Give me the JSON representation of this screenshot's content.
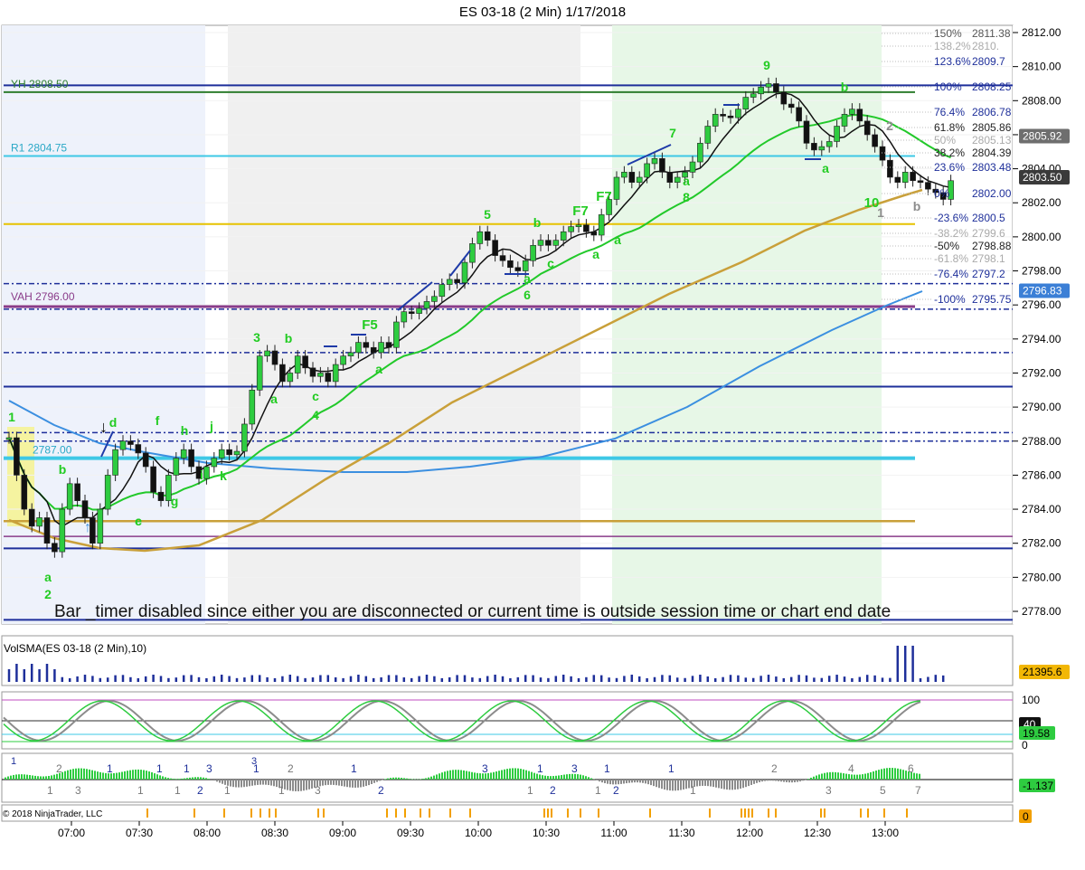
{
  "header": {
    "title": "ES 03-18 (2 Min)  1/17/2018"
  },
  "chart_data": {
    "type": "candlestick",
    "instrument": "ES 03-18 (2 Min)",
    "date": "1/17/2018",
    "ylim": [
      2777,
      2812.5
    ],
    "y_ticks": [
      "2812.00",
      "2810.00",
      "2808.00",
      "2806.00",
      "2804.00",
      "2802.00",
      "2800.00",
      "2798.00",
      "2796.00",
      "2794.00",
      "2792.00",
      "2790.00",
      "2788.00",
      "2786.00",
      "2784.00",
      "2782.00",
      "2780.00",
      "2778.00"
    ],
    "y_tick_values": [
      2812,
      2810,
      2808,
      2806,
      2804,
      2802,
      2800,
      2798,
      2796,
      2794,
      2792,
      2790,
      2788,
      2786,
      2784,
      2782,
      2780,
      2778
    ],
    "x_ticks": [
      "07:00",
      "07:30",
      "08:00",
      "08:30",
      "09:00",
      "09:30",
      "10:00",
      "10:30",
      "11:00",
      "11:30",
      "12:00",
      "12:30",
      "13:00"
    ],
    "price_path": [
      [
        0,
        2788.2
      ],
      [
        2,
        2786
      ],
      [
        4,
        2784
      ],
      [
        6,
        2783
      ],
      [
        8,
        2783.5
      ],
      [
        10,
        2782
      ],
      [
        12,
        2781.5
      ],
      [
        14,
        2784
      ],
      [
        16,
        2785.5
      ],
      [
        18,
        2784.5
      ],
      [
        20,
        2783.5
      ],
      [
        22,
        2782
      ],
      [
        24,
        2784
      ],
      [
        26,
        2786
      ],
      [
        28,
        2787.5
      ],
      [
        30,
        2788
      ],
      [
        32,
        2787.8
      ],
      [
        34,
        2787.3
      ],
      [
        36,
        2786.5
      ],
      [
        38,
        2785
      ],
      [
        40,
        2784.5
      ],
      [
        42,
        2786
      ],
      [
        44,
        2787
      ],
      [
        46,
        2787.5
      ],
      [
        48,
        2786.5
      ],
      [
        50,
        2785.8
      ],
      [
        52,
        2786.5
      ],
      [
        54,
        2787
      ],
      [
        56,
        2787.5
      ],
      [
        58,
        2787.2
      ],
      [
        60,
        2787.4
      ],
      [
        62,
        2789
      ],
      [
        64,
        2791
      ],
      [
        66,
        2793
      ],
      [
        68,
        2793.3
      ],
      [
        70,
        2792.5
      ],
      [
        72,
        2791.5
      ],
      [
        74,
        2792
      ],
      [
        76,
        2793
      ],
      [
        78,
        2792.3
      ],
      [
        80,
        2791.8
      ],
      [
        82,
        2792
      ],
      [
        84,
        2791.5
      ],
      [
        86,
        2792.5
      ],
      [
        88,
        2793
      ],
      [
        90,
        2793.2
      ],
      [
        92,
        2793.8
      ],
      [
        94,
        2793.5
      ],
      [
        96,
        2793.2
      ],
      [
        98,
        2793.8
      ],
      [
        100,
        2793.5
      ],
      [
        102,
        2795
      ],
      [
        104,
        2795.6
      ],
      [
        106,
        2795.5
      ],
      [
        108,
        2795.8
      ],
      [
        110,
        2796.2
      ],
      [
        112,
        2796.5
      ],
      [
        114,
        2797.2
      ],
      [
        116,
        2797.5
      ],
      [
        118,
        2797.3
      ],
      [
        120,
        2798.5
      ],
      [
        122,
        2799.6
      ],
      [
        124,
        2800.3
      ],
      [
        126,
        2799.8
      ],
      [
        128,
        2798.9
      ],
      [
        130,
        2798.6
      ],
      [
        132,
        2798.2
      ],
      [
        134,
        2798
      ],
      [
        136,
        2798.6
      ],
      [
        138,
        2799.5
      ],
      [
        140,
        2799.8
      ],
      [
        142,
        2799.5
      ],
      [
        144,
        2799.8
      ],
      [
        146,
        2800.3
      ],
      [
        148,
        2800.6
      ],
      [
        150,
        2800.7
      ],
      [
        152,
        2800.3
      ],
      [
        154,
        2800.1
      ],
      [
        156,
        2801.3
      ],
      [
        158,
        2802.2
      ],
      [
        160,
        2803.5
      ],
      [
        162,
        2803.8
      ],
      [
        164,
        2803.2
      ],
      [
        166,
        2803.5
      ],
      [
        168,
        2804.3
      ],
      [
        170,
        2804.6
      ],
      [
        172,
        2803.8
      ],
      [
        174,
        2803.2
      ],
      [
        176,
        2803.5
      ],
      [
        178,
        2803.8
      ],
      [
        180,
        2804.4
      ],
      [
        182,
        2805.5
      ],
      [
        184,
        2806.5
      ],
      [
        186,
        2807.2
      ],
      [
        188,
        2807.1
      ],
      [
        190,
        2807
      ],
      [
        192,
        2807.5
      ],
      [
        194,
        2808.2
      ],
      [
        196,
        2808.4
      ],
      [
        198,
        2808.8
      ],
      [
        200,
        2809
      ],
      [
        202,
        2808.5
      ],
      [
        204,
        2807.8
      ],
      [
        206,
        2807.6
      ],
      [
        208,
        2806.8
      ],
      [
        210,
        2805.5
      ],
      [
        212,
        2805.1
      ],
      [
        214,
        2805.3
      ],
      [
        216,
        2805.6
      ],
      [
        218,
        2806.5
      ],
      [
        220,
        2807.2
      ],
      [
        222,
        2807.5
      ],
      [
        224,
        2806.8
      ],
      [
        226,
        2806
      ],
      [
        228,
        2805.3
      ],
      [
        230,
        2804.5
      ],
      [
        232,
        2803.5
      ],
      [
        234,
        2803.2
      ],
      [
        236,
        2803.8
      ],
      [
        238,
        2803.3
      ],
      [
        240,
        2803.2
      ],
      [
        242,
        2802.8
      ],
      [
        244,
        2802.6
      ],
      [
        246,
        2802.2
      ],
      [
        248,
        2803.3
      ]
    ],
    "levels": [
      {
        "label": "YH 2808.50",
        "value": 2808.5,
        "color": "#1a6b1a"
      },
      {
        "label": "R1 2804.75",
        "value": 2804.75,
        "color": "#3ec8e6"
      },
      {
        "label": "VAH 2796.00",
        "value": 2796.0,
        "color": "#8a3c8a"
      },
      {
        "label": "2787.00",
        "value": 2787.0,
        "color": "#3ec8e6"
      }
    ],
    "fib_levels": [
      {
        "label": "150%",
        "value": "2811.38"
      },
      {
        "label": "138.2%",
        "value": "2810."
      },
      {
        "label": "123.6%",
        "value": "2809.7"
      },
      {
        "label": "100%",
        "value": "2808.25"
      },
      {
        "label": "76.4%",
        "value": "2806.78"
      },
      {
        "label": "61.8%",
        "value": "2805.86"
      },
      {
        "label": "50%",
        "value": "2805.13"
      },
      {
        "label": "38.2%",
        "value": "2804.39"
      },
      {
        "label": "23.6%",
        "value": "2803.48"
      },
      {
        "label": "0%",
        "value": "2802.00"
      },
      {
        "label": "-23.6%",
        "value": "2800.5"
      },
      {
        "label": "-38.2%",
        "value": "2799.6"
      },
      {
        "label": "-50%",
        "value": "2798.88"
      },
      {
        "label": "-61.8%",
        "value": "2798.1"
      },
      {
        "label": "-76.4%",
        "value": "2797.2"
      },
      {
        "label": "-100%",
        "value": "2795.75"
      }
    ],
    "price_badges": [
      {
        "text": "2805.92",
        "value": 2805.92,
        "bg": "#6e6e6e",
        "fg": "#ffffff"
      },
      {
        "text": "2803.50",
        "value": 2803.5,
        "bg": "#3a3a3a",
        "fg": "#ffffff"
      },
      {
        "text": "2796.83",
        "value": 2796.83,
        "bg": "#3b7fd6",
        "fg": "#ffffff"
      }
    ],
    "wave_labels": [
      "1",
      "2",
      "a",
      "b",
      "c",
      "d",
      "e",
      "f",
      "g",
      "h",
      "i",
      "j",
      "k",
      "3",
      "b",
      "a",
      "c",
      "4",
      "F5",
      "a",
      "5",
      "b",
      "c",
      "a",
      "6",
      "a",
      "F7",
      "F7",
      "a",
      "7",
      "a",
      "8",
      "9",
      "b",
      "a",
      "2",
      "10",
      "1",
      "b"
    ],
    "notice": "Bar _timer disabled since either you are disconnected or current time is outside session time or chart end date",
    "volume_panel": {
      "label": "VolSMA(ES 03-18 (2 Min),10)",
      "badge": "21395.6"
    },
    "oscillator_panel": {
      "ticks": [
        "100",
        "0"
      ],
      "badge_top": "40",
      "badge_bottom": "19.58"
    },
    "histogram_panel": {
      "badge": "-1.137",
      "numbers_top": [
        "1",
        "2",
        "1",
        "1",
        "1",
        "3",
        "1",
        "2",
        "1",
        "3",
        "1",
        "3",
        "1",
        "1",
        "3",
        "2",
        "4",
        "6"
      ],
      "numbers_bottom": [
        "1",
        "3",
        "1",
        "1",
        "2",
        "1",
        "1",
        "3",
        "2",
        "1",
        "2",
        "1",
        "2",
        "1",
        "3",
        "5",
        "7"
      ]
    },
    "marker_panel": {
      "badge": "0"
    },
    "copyright": "© 2018 NinjaTrader, LLC"
  }
}
